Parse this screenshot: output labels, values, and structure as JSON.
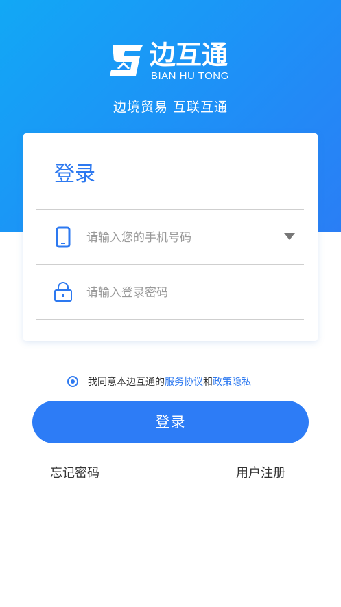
{
  "brand": {
    "name_cn": "边互通",
    "name_en": "BIAN HU TONG",
    "slogan": "边境贸易  互联互通"
  },
  "login_card": {
    "title": "登录",
    "phone_placeholder": "请输入您的手机号码",
    "password_placeholder": "请输入登录密码"
  },
  "agreement": {
    "prefix": "我同意本边互通的",
    "service_link": "服务协议",
    "conjunction": "和",
    "privacy_link": "政策隐私",
    "checked": true
  },
  "actions": {
    "login_button": "登录",
    "forgot_password": "忘记密码",
    "register": "用户注册"
  },
  "colors": {
    "primary": "#2d7cf6",
    "hero_gradient_start": "#12a8f5",
    "hero_gradient_end": "#2a7ef5"
  },
  "icons": {
    "phone": "phone-icon",
    "lock": "lock-icon",
    "dropdown": "triangle-down-icon"
  }
}
